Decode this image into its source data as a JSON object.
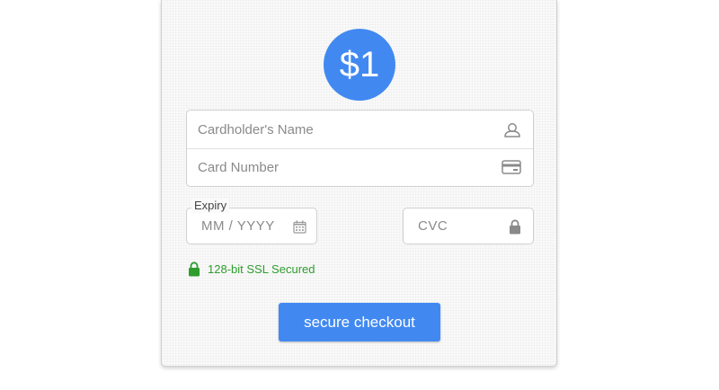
{
  "payment": {
    "amount": "$1"
  },
  "form": {
    "name_placeholder": "Cardholder's Name",
    "card_placeholder": "Card Number",
    "expiry_label": "Expiry",
    "expiry_placeholder": "MM / YYYY",
    "cvc_placeholder": "CVC",
    "ssl_text": "128-bit SSL Secured",
    "submit_label": "secure checkout"
  },
  "colors": {
    "accent": "#4189f1",
    "secure_green": "#2e9d2e",
    "icon_gray": "#8a8a8a"
  },
  "icons": [
    "user-icon",
    "credit-card-icon",
    "calendar-icon",
    "lock-icon",
    "ssl-lock-icon"
  ]
}
